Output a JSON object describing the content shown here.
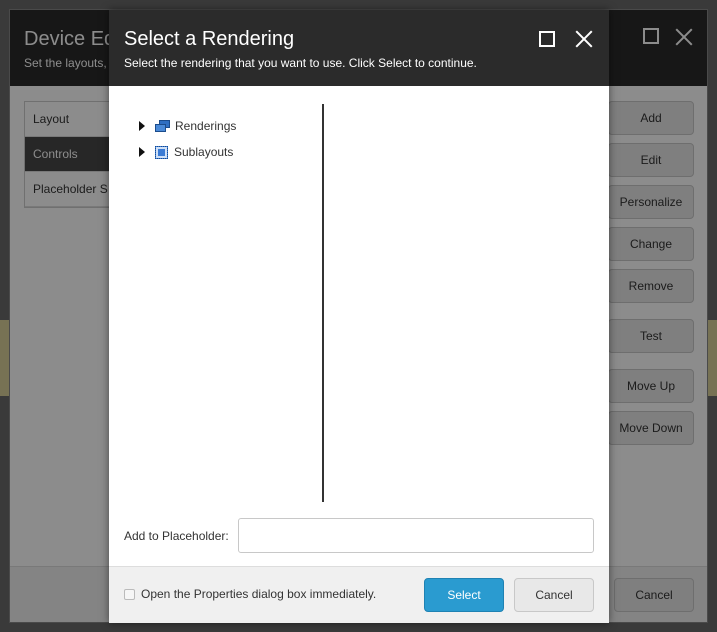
{
  "outer_dialog": {
    "title": "Device Editor",
    "subtitle": "Set the layouts,",
    "tabs": [
      "Layout",
      "Controls",
      "Placeholder S"
    ],
    "buttons": [
      "Add",
      "Edit",
      "Personalize",
      "Change",
      "Remove",
      "Test",
      "Move Up",
      "Move Down"
    ],
    "cancel_label": "Cancel"
  },
  "dialog": {
    "title": "Select a Rendering",
    "subtitle": "Select the rendering that you want to use. Click Select to continue.",
    "tree": [
      {
        "label": "Renderings",
        "icon": "renderings-icon"
      },
      {
        "label": "Sublayouts",
        "icon": "sublayouts-icon"
      }
    ],
    "placeholder_label": "Add to Placeholder:",
    "placeholder_value": "",
    "checkbox_label": "Open the Properties dialog box immediately.",
    "checkbox_checked": false,
    "select_label": "Select",
    "cancel_label": "Cancel"
  },
  "colors": {
    "header": "#2b2b2b",
    "primary_button": "#2a9bd0",
    "active_tab": "#474747"
  }
}
